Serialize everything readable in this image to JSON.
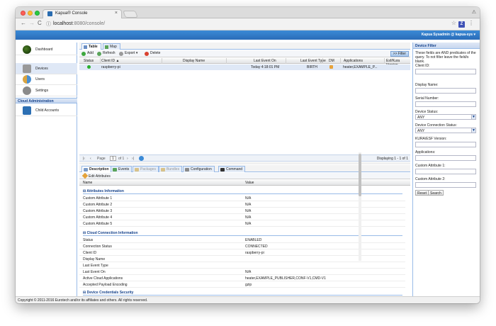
{
  "browser": {
    "tab_title": "Kapua® Console",
    "tab_close": "×",
    "url_host": "localhost",
    "url_path": ":8080/console/",
    "ext_label": "Z",
    "tab_user": "⚠"
  },
  "header": {
    "user_menu": "Kapua Sysadmin @ kapua-sys ▾"
  },
  "sidebar": {
    "items": [
      {
        "label": "Dashboard"
      },
      {
        "label": "Devices"
      },
      {
        "label": "Users"
      },
      {
        "label": "Settings"
      }
    ],
    "section": "Cloud Administration",
    "admin_items": [
      {
        "label": "Child Accounts"
      }
    ]
  },
  "view_tabs": {
    "table": "Table",
    "map": "Map"
  },
  "toolbar": {
    "add": "Add",
    "refresh": "Refresh",
    "export": "Export",
    "export_caret": "▾",
    "delete": "Delete",
    "filter": ">> Filter"
  },
  "grid": {
    "columns": [
      "Status",
      "Client ID ▲",
      "Display Name",
      "Last Event On",
      "Last Event Type",
      "DM",
      "Applications",
      "Esf/Kura Version"
    ],
    "rows": [
      {
        "client_id": "raspberry-pi",
        "display_name": "",
        "last_event_on": "Today 4:18:01 PM",
        "last_event_type": "BIRTH",
        "applications": "heater,EXAMPLE_P...",
        "version": ""
      }
    ]
  },
  "pager": {
    "first": "|‹",
    "prev": "‹",
    "page_label": "Page",
    "page_value": "1",
    "of": "of 1",
    "next": "›",
    "last": "›|",
    "displaying": "Displaying 1 - 1 of 1"
  },
  "detail_tabs": [
    "Description",
    "Events",
    "Packages",
    "Bundles",
    "Configuration",
    "Command"
  ],
  "edit_attributes": "Edit Attributes",
  "props": {
    "col_name": "Name",
    "col_value": "Value",
    "groups": [
      {
        "title": "Attributes Information",
        "rows": [
          {
            "k": "Custom Attribute 1",
            "v": "N/A"
          },
          {
            "k": "Custom Attribute 2",
            "v": "N/A"
          },
          {
            "k": "Custom Attribute 3",
            "v": "N/A"
          },
          {
            "k": "Custom Attribute 4",
            "v": "N/A"
          },
          {
            "k": "Custom Attribute 5",
            "v": "N/A"
          }
        ]
      },
      {
        "title": "Cloud Connection Information",
        "rows": [
          {
            "k": "Status",
            "v": "ENABLED"
          },
          {
            "k": "Connection Status",
            "v": "CONNECTED"
          },
          {
            "k": "Client ID",
            "v": "raspberry-pi"
          },
          {
            "k": "Display Name",
            "v": ""
          },
          {
            "k": "Last Event Type",
            "v": ""
          },
          {
            "k": "Last Event On",
            "v": "N/A"
          },
          {
            "k": "Active Cloud Applications",
            "v": "heater,EXAMPLE_PUBLISHER,CONF-V1,CMD-V1"
          },
          {
            "k": "Accepted Payload Encoding",
            "v": "gzip"
          }
        ]
      },
      {
        "title": "Device Credentials Security",
        "rows": []
      }
    ]
  },
  "filter_panel": {
    "title": "Device Filter",
    "description": "These fields are AND predicates of the query. To not filter leave the field/s blank.",
    "client_id": "Client ID:",
    "display_name": "Display Name:",
    "serial_number": "Serial Number:",
    "device_status": "Device Status:",
    "device_status_value": "ANY",
    "connection_status": "Device Connection Status:",
    "connection_status_value": "ANY",
    "kura_version": "KURA/ESF Version:",
    "applications": "Applications:",
    "custom_1": "Custom Attribute 1:",
    "custom_2": "Custom Attribute 2:",
    "reset": "Reset",
    "search": "Search"
  },
  "footer": "Copyright © 2011-2016 Eurotech and/or its affiliates and others. All rights reserved."
}
